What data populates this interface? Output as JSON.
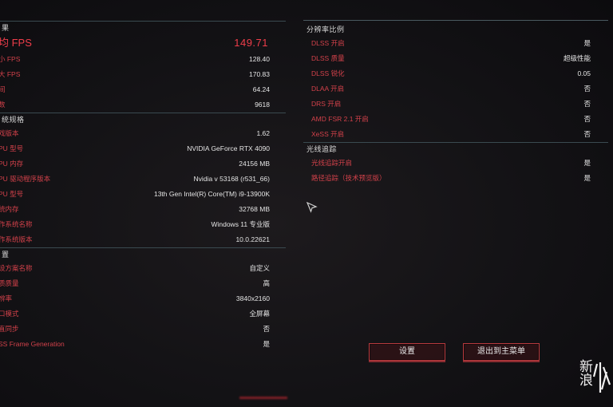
{
  "left": {
    "sections": [
      {
        "title": "果",
        "rows": [
          {
            "label": "均 FPS",
            "value": "149.71",
            "big": true
          },
          {
            "label": "小 FPS",
            "value": "128.40"
          },
          {
            "label": "大 FPS",
            "value": "170.83"
          },
          {
            "label": "间",
            "value": "64.24"
          },
          {
            "label": "数",
            "value": "9618"
          }
        ]
      },
      {
        "title": "统规格",
        "rows": [
          {
            "label": "戏版本",
            "value": "1.62"
          },
          {
            "label": "PU 型号",
            "value": "NVIDIA GeForce RTX 4090"
          },
          {
            "label": "PU 内存",
            "value": "24156 MB"
          },
          {
            "label": "PU 驱动程序版本",
            "value": "Nvidia v 53168 (r531_66)"
          },
          {
            "label": "PU 型号",
            "value": "13th Gen Intel(R) Core(TM) i9-13900K"
          },
          {
            "label": "统内存",
            "value": "32768 MB"
          },
          {
            "label": "作系统名称",
            "value": "Windows 11 专业版"
          },
          {
            "label": "作系统版本",
            "value": "10.0.22621"
          }
        ]
      },
      {
        "title": "置",
        "rows": [
          {
            "label": "设方案名称",
            "value": "自定义"
          },
          {
            "label": "质质量",
            "value": "高"
          },
          {
            "label": "辨率",
            "value": "3840x2160"
          },
          {
            "label": "口模式",
            "value": "全屏幕"
          },
          {
            "label": "直同步",
            "value": "否"
          },
          {
            "label": "SS Frame Generation",
            "value": "是"
          }
        ]
      }
    ]
  },
  "right": {
    "sections": [
      {
        "title": "分辨率比例",
        "rows": [
          {
            "label": "DLSS 开启",
            "value": "是"
          },
          {
            "label": "DLSS 质量",
            "value": "超级性能"
          },
          {
            "label": "DLSS 锐化",
            "value": "0.05"
          },
          {
            "label": "DLAA 开启",
            "value": "否"
          },
          {
            "label": "DRS 开启",
            "value": "否"
          },
          {
            "label": "AMD FSR 2.1 开启",
            "value": "否"
          },
          {
            "label": "XeSS 开启",
            "value": "否"
          }
        ]
      },
      {
        "title": "光线追踪",
        "rows": [
          {
            "label": "光线追踪开启",
            "value": "是"
          },
          {
            "label": "路径追踪（技术预览版）",
            "value": "是"
          }
        ]
      }
    ]
  },
  "buttons": {
    "settings": "设置",
    "exit_main_menu": "退出到主菜单"
  },
  "watermark": {
    "text": "新浪"
  },
  "colors": {
    "accent_red": "#d2414a",
    "fps_red": "#ef3d4a",
    "button_border": "#b83a3e",
    "divider": "#3a4a50"
  }
}
